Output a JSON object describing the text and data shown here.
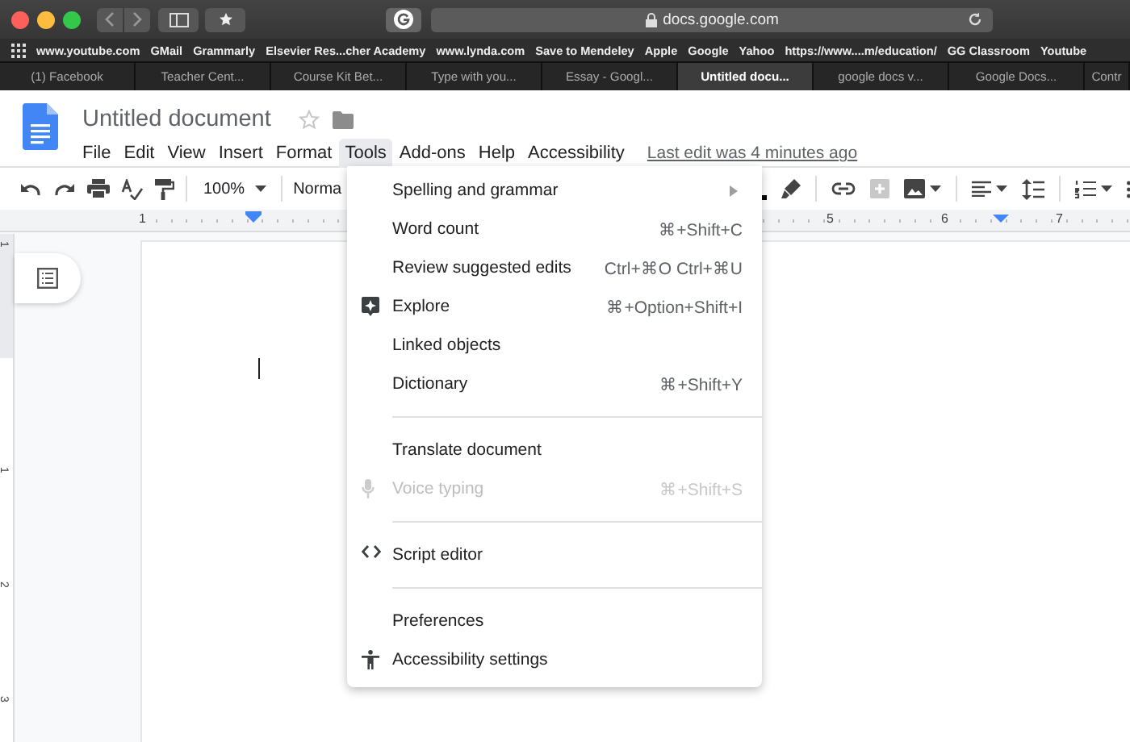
{
  "browser": {
    "address": "docs.google.com",
    "bookmarks": [
      "www.youtube.com",
      "GMail",
      "Grammarly",
      "Elsevier Res...cher Academy",
      "www.lynda.com",
      "Save to Mendeley",
      "Apple",
      "Google",
      "Yahoo",
      "https://www....m/education/",
      "GG Classroom",
      "Youtube"
    ],
    "tabs": [
      {
        "label": "(1) Facebook",
        "selected": false
      },
      {
        "label": "Teacher Cent...",
        "selected": false
      },
      {
        "label": "Course Kit Bet...",
        "selected": false
      },
      {
        "label": "Type with you...",
        "selected": false
      },
      {
        "label": "Essay - Googl...",
        "selected": false
      },
      {
        "label": "Untitled docu...",
        "selected": true
      },
      {
        "label": "google docs v...",
        "selected": false
      },
      {
        "label": "Google Docs...",
        "selected": false
      },
      {
        "label": "Contr",
        "selected": false
      }
    ]
  },
  "document": {
    "title": "Untitled document",
    "menu": [
      {
        "label": "File",
        "selected": false
      },
      {
        "label": "Edit",
        "selected": false
      },
      {
        "label": "View",
        "selected": false
      },
      {
        "label": "Insert",
        "selected": false
      },
      {
        "label": "Format",
        "selected": false
      },
      {
        "label": "Tools",
        "selected": true
      },
      {
        "label": "Add-ons",
        "selected": false
      },
      {
        "label": "Help",
        "selected": false
      },
      {
        "label": "Accessibility",
        "selected": false
      }
    ],
    "last_edit": "Last edit was 4 minutes ago"
  },
  "toolbar": {
    "zoom": "100%",
    "style": "Norma"
  },
  "ruler": {
    "left_labels": [
      "1"
    ],
    "right_labels": [
      "5",
      "6",
      "7"
    ],
    "vertical_labels": [
      "1",
      "1",
      "2",
      "3"
    ]
  },
  "tools_menu": [
    {
      "kind": "plain",
      "label": "Spelling and grammar",
      "submenu": true,
      "disabled": false
    },
    {
      "kind": "plain",
      "label": "Word count",
      "shortcut": "⌘+Shift+C",
      "submenu": false,
      "disabled": false
    },
    {
      "kind": "plain",
      "label": "Review suggested edits",
      "shortcut": "Ctrl+⌘O Ctrl+⌘U",
      "submenu": false,
      "disabled": false
    },
    {
      "kind": "explore",
      "label": "Explore",
      "shortcut": "⌘+Option+Shift+I",
      "submenu": false,
      "disabled": false
    },
    {
      "kind": "plain",
      "label": "Linked objects",
      "submenu": false,
      "disabled": false
    },
    {
      "kind": "plain",
      "label": "Dictionary",
      "shortcut": "⌘+Shift+Y",
      "submenu": false,
      "disabled": false
    },
    {
      "kind": "separator"
    },
    {
      "kind": "plain",
      "label": "Translate document",
      "submenu": false,
      "disabled": false
    },
    {
      "kind": "voice",
      "label": "Voice typing",
      "shortcut": "⌘+Shift+S",
      "submenu": false,
      "disabled": true
    },
    {
      "kind": "separator"
    },
    {
      "kind": "script",
      "label": "Script editor",
      "submenu": false,
      "disabled": false
    },
    {
      "kind": "separator"
    },
    {
      "kind": "plain",
      "label": "Preferences",
      "submenu": false,
      "disabled": false
    },
    {
      "kind": "accessibility",
      "label": "Accessibility settings",
      "submenu": false,
      "disabled": false
    }
  ]
}
